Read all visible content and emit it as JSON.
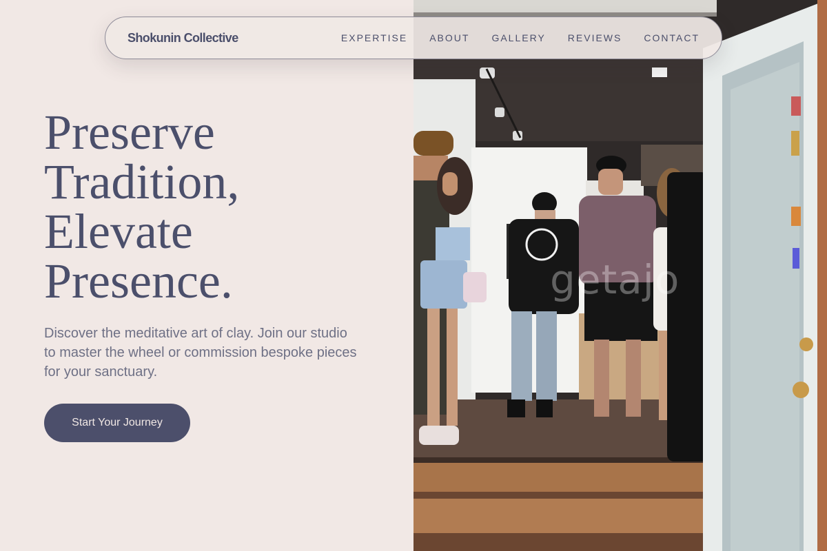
{
  "nav": {
    "brand": "Shokunin Collective",
    "links": [
      "EXPERTISE",
      "ABOUT",
      "GALLERY",
      "REVIEWS",
      "CONTACT"
    ]
  },
  "hero": {
    "title_lines": [
      "Preserve",
      "Tradition,",
      "Elevate",
      "Presence."
    ],
    "description": "Discover the meditative art of clay. Join our studio to master the wheel or commission bespoke pieces for your sanctuary.",
    "cta_label": "Start Your Journey"
  },
  "photo": {
    "watermark": "getajo"
  },
  "colors": {
    "background": "#f1e8e5",
    "ink": "#4b4f6b",
    "muted": "#6e7085",
    "button": "#4c4f6b"
  }
}
